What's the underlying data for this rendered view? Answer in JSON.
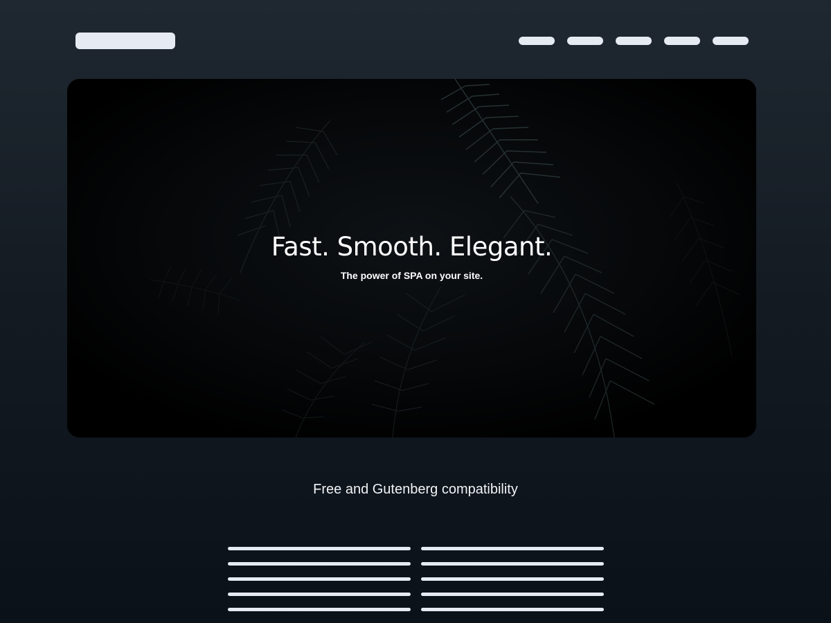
{
  "header": {
    "nav_items": [
      "",
      "",
      "",
      "",
      ""
    ]
  },
  "hero": {
    "title": "Fast. Smooth. Elegant.",
    "subtitle": "The power of SPA on your site."
  },
  "features": {
    "heading": "Free and Gutenberg compatibility"
  },
  "colors": {
    "background_top": "#1f2831",
    "background_bottom": "#0b1118",
    "placeholder": "#e6ebf3",
    "hero_bg": "#000000"
  }
}
